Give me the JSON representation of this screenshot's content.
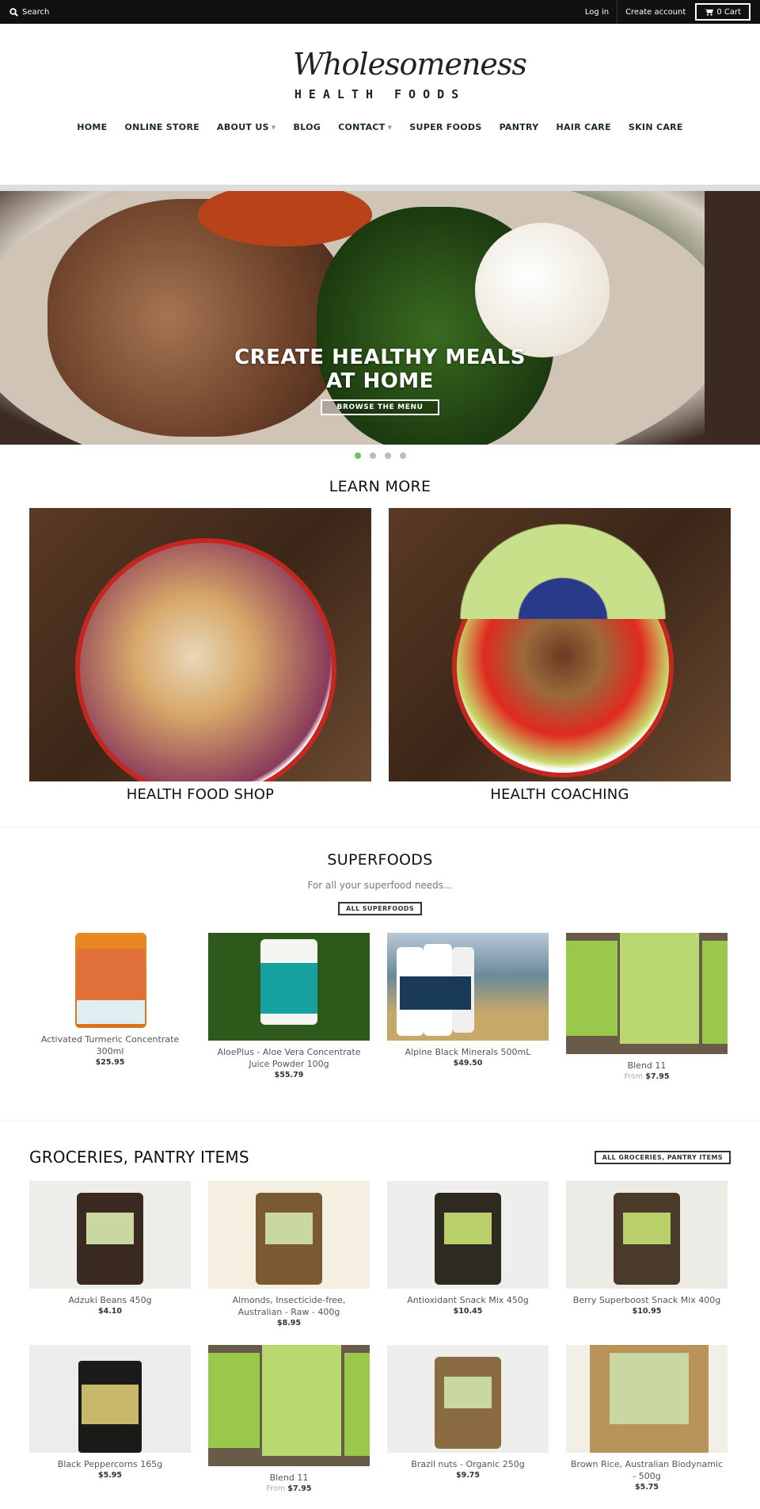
{
  "topbar": {
    "search_label": "Search",
    "login_label": "Log in",
    "create_account_label": "Create account",
    "cart_label": "0 Cart"
  },
  "logo": {
    "script": "Wholesomeness",
    "subtitle": "HEALTH FOODS"
  },
  "nav": {
    "items": [
      {
        "label": "HOME",
        "dropdown": false
      },
      {
        "label": "ONLINE STORE",
        "dropdown": false
      },
      {
        "label": "ABOUT US",
        "dropdown": true
      },
      {
        "label": "BLOG",
        "dropdown": false
      },
      {
        "label": "CONTACT",
        "dropdown": true
      },
      {
        "label": "SUPER FOODS",
        "dropdown": false
      },
      {
        "label": "PANTRY",
        "dropdown": false
      },
      {
        "label": "HAIR CARE",
        "dropdown": false
      },
      {
        "label": "SKIN CARE",
        "dropdown": false
      }
    ]
  },
  "hero": {
    "title_line1": "CREATE HEALTHY MEALS",
    "title_line2": "AT HOME",
    "button_label": "BROWSE THE MENU",
    "slide_count": 4,
    "active_slide": 1,
    "active_dot_color": "#6ec060"
  },
  "learn_more": {
    "title": "LEARN MORE",
    "cards": [
      {
        "caption": "HEALTH FOOD SHOP"
      },
      {
        "caption": "HEALTH COACHING"
      }
    ]
  },
  "superfoods": {
    "title": "SUPERFOODS",
    "subtitle": "For all your superfood needs...",
    "button_label": "ALL SUPERFOODS",
    "products": [
      {
        "name": "Activated Turmeric Concentrate 300ml",
        "price": "$25.95",
        "from": ""
      },
      {
        "name": "AloePlus - Aloe Vera Concentrate Juice Powder 100g",
        "price": "$55.79",
        "from": ""
      },
      {
        "name": "Alpine Black Minerals 500mL",
        "price": "$49.50",
        "from": ""
      },
      {
        "name": "Blend 11",
        "price": "$7.95",
        "from": "From"
      }
    ]
  },
  "groceries": {
    "title": "GROCERIES, PANTRY ITEMS",
    "button_label": "ALL GROCERIES, PANTRY ITEMS",
    "products": [
      {
        "name": "Adzuki Beans 450g",
        "price": "$4.10",
        "from": ""
      },
      {
        "name": "Almonds, Insecticide-free, Australian - Raw - 400g",
        "price": "$8.95",
        "from": ""
      },
      {
        "name": "Antioxidant Snack Mix 450g",
        "price": "$10.45",
        "from": ""
      },
      {
        "name": "Berry Superboost Snack Mix 400g",
        "price": "$10.95",
        "from": ""
      },
      {
        "name": "Black Peppercorns 165g",
        "price": "$5.95",
        "from": ""
      },
      {
        "name": "Blend 11",
        "price": "$7.95",
        "from": "From"
      },
      {
        "name": "Brazil nuts - Organic 250g",
        "price": "$9.75",
        "from": ""
      },
      {
        "name": "Brown Rice, Australian Biodynamic - 500g",
        "price": "$5.75",
        "from": ""
      }
    ]
  }
}
